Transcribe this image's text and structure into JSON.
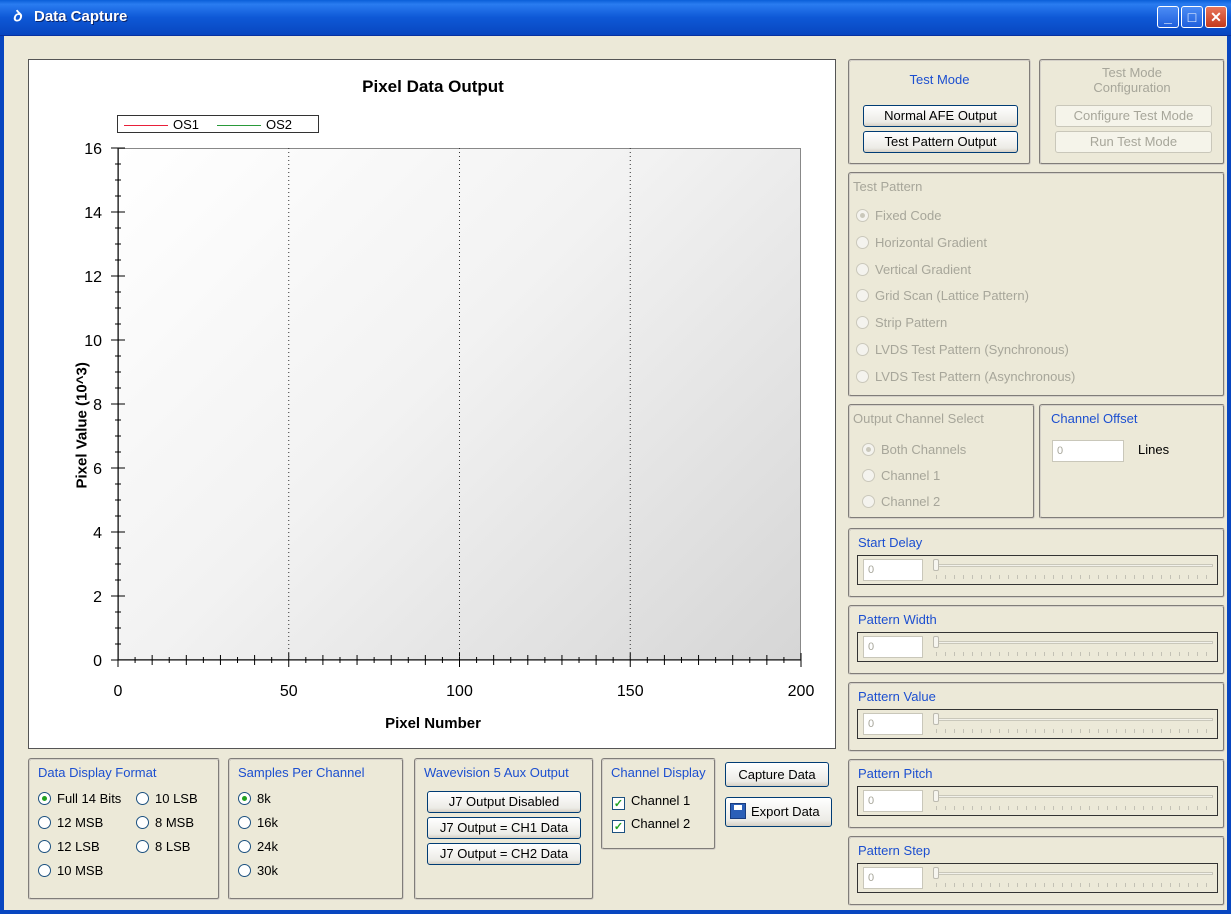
{
  "window": {
    "title": "Data Capture",
    "icon": "app-logo-icon"
  },
  "chart_data": {
    "type": "line",
    "title": "Pixel Data Output",
    "xlabel": "Pixel Number",
    "ylabel": "Pixel Value (10^3)",
    "xlim": [
      0,
      200
    ],
    "ylim": [
      0,
      16
    ],
    "xticks": [
      "0",
      "50",
      "100",
      "150",
      "200"
    ],
    "yticks": [
      "0",
      "2",
      "4",
      "6",
      "8",
      "10",
      "12",
      "14",
      "16"
    ],
    "legend_position": "top-left",
    "grid": "vertical dotted",
    "series": [
      {
        "name": "OS1",
        "color": "#e8203a",
        "values": []
      },
      {
        "name": "OS2",
        "color": "#2a9a3a",
        "values": []
      }
    ]
  },
  "test_mode": {
    "title": "Test Mode",
    "normal_btn": "Normal AFE Output",
    "pattern_btn": "Test Pattern Output"
  },
  "test_mode_config": {
    "title": "Test Mode Configuration",
    "configure_btn": "Configure Test Mode",
    "run_btn": "Run Test Mode"
  },
  "test_pattern": {
    "title": "Test Pattern",
    "options": [
      "Fixed Code",
      "Horizontal Gradient",
      "Vertical Gradient",
      "Grid Scan (Lattice Pattern)",
      "Strip Pattern",
      "LVDS Test Pattern (Synchronous)",
      "LVDS Test Pattern (Asynchronous)"
    ],
    "selected": "Fixed Code"
  },
  "output_channel": {
    "title": "Output Channel Select",
    "options": [
      "Both Channels",
      "Channel 1",
      "Channel 2"
    ],
    "selected": "Both Channels"
  },
  "channel_offset": {
    "title": "Channel Offset",
    "value": "0",
    "unit": "Lines"
  },
  "sliders": [
    {
      "title": "Start Delay",
      "value": "0"
    },
    {
      "title": "Pattern Width",
      "value": "0"
    },
    {
      "title": "Pattern Value",
      "value": "0"
    },
    {
      "title": "Pattern Pitch",
      "value": "0"
    },
    {
      "title": "Pattern Step",
      "value": "0"
    }
  ],
  "data_display_format": {
    "title": "Data Display Format",
    "options": [
      "Full 14 Bits",
      "10 LSB",
      "12 MSB",
      "8 MSB",
      "12 LSB",
      "8 LSB",
      "10 MSB"
    ],
    "selected": "Full 14 Bits"
  },
  "samples_per_channel": {
    "title": "Samples Per Channel",
    "options": [
      "8k",
      "16k",
      "24k",
      "30k"
    ],
    "selected": "8k"
  },
  "aux_output": {
    "title": "Wavevision 5 Aux Output",
    "buttons": [
      "J7 Output Disabled",
      "J7 Output = CH1 Data",
      "J7 Output = CH2 Data"
    ]
  },
  "channel_display": {
    "title": "Channel Display",
    "channel1": "Channel 1",
    "channel2": "Channel 2"
  },
  "actions": {
    "capture": "Capture Data",
    "export": "Export Data"
  }
}
